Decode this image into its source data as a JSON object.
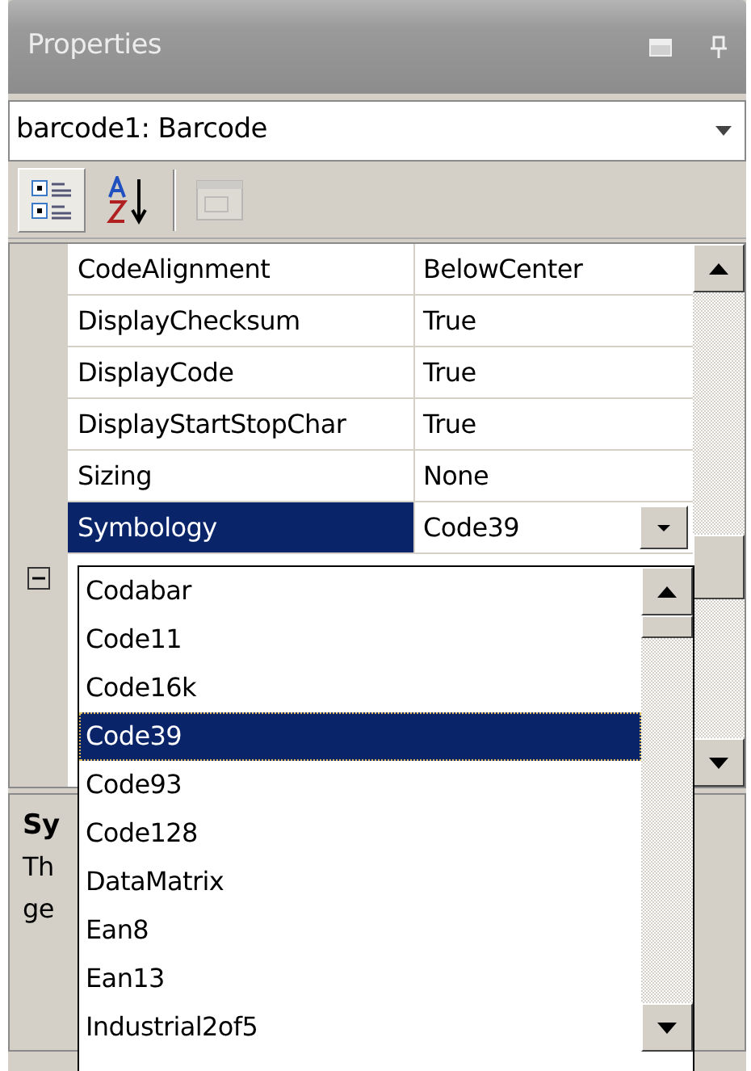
{
  "panel": {
    "title": "Properties"
  },
  "object_selector": {
    "value": "barcode1: Barcode"
  },
  "toolbar": [
    {
      "kind": "categorized",
      "selected": true,
      "disabled": false
    },
    {
      "kind": "alphabetical",
      "selected": false,
      "disabled": false
    },
    {
      "kind": "property-pages",
      "selected": false,
      "disabled": true
    }
  ],
  "properties": [
    {
      "name": "CodeAlignment",
      "value": "BelowCenter",
      "selected": false
    },
    {
      "name": "DisplayChecksum",
      "value": "True",
      "selected": false
    },
    {
      "name": "DisplayCode",
      "value": "True",
      "selected": false
    },
    {
      "name": "DisplayStartStopChar",
      "value": "True",
      "selected": false
    },
    {
      "name": "Sizing",
      "value": "None",
      "selected": false
    },
    {
      "name": "Symbology",
      "value": "Code39",
      "selected": true
    }
  ],
  "category": {
    "expanded": true
  },
  "dropdown": {
    "items": [
      {
        "label": "Codabar",
        "selected": false
      },
      {
        "label": "Code11",
        "selected": false
      },
      {
        "label": "Code16k",
        "selected": false
      },
      {
        "label": "Code39",
        "selected": true
      },
      {
        "label": "Code93",
        "selected": false
      },
      {
        "label": "Code128",
        "selected": false
      },
      {
        "label": "DataMatrix",
        "selected": false
      },
      {
        "label": "Ean8",
        "selected": false
      },
      {
        "label": "Ean13",
        "selected": false
      },
      {
        "label": "Industrial2of5",
        "selected": false
      }
    ]
  },
  "description": {
    "title": "Sy",
    "lines": [
      "Th",
      "ge"
    ]
  }
}
